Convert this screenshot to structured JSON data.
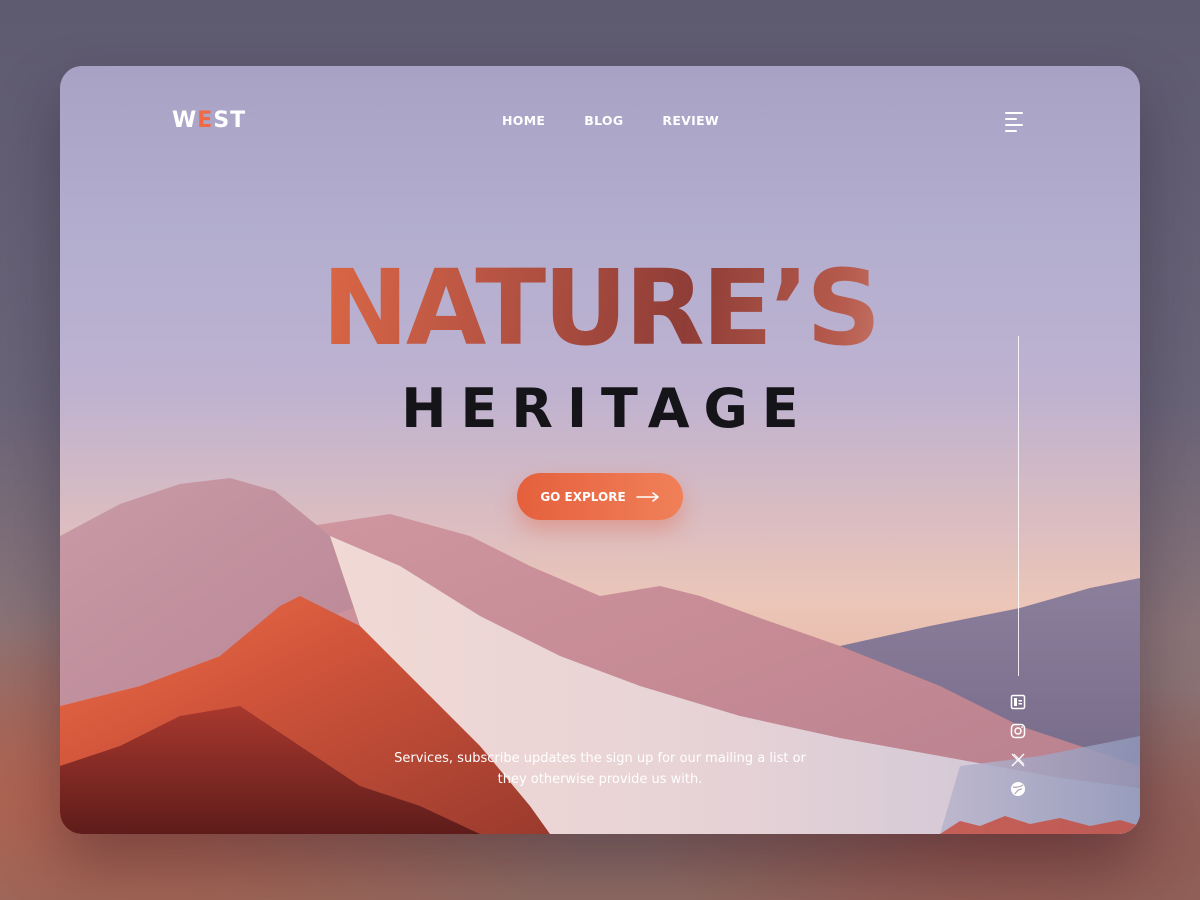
{
  "brand": {
    "prefix": "W",
    "accent": "E",
    "suffix": "ST",
    "accent_color": "#f06a46"
  },
  "nav": {
    "items": [
      "HOME",
      "BLOG",
      "REVIEW"
    ],
    "menu_icon": "hamburger-menu-icon"
  },
  "hero": {
    "title": "NATURE’S",
    "subtitle": "HERITAGE",
    "cta_label": "GO EXPLORE",
    "cta_icon": "arrow-right-icon",
    "cta_color": "#e5603d"
  },
  "tagline": {
    "line1": "Services, subscribe updates the sign up for our mailing a list or",
    "line2": "they otherwise provide us with."
  },
  "socials": [
    "blog-icon",
    "instagram-icon",
    "x-icon",
    "dribbble-icon"
  ]
}
